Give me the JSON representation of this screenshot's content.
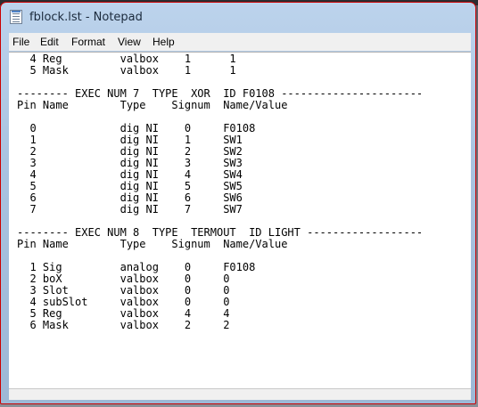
{
  "window": {
    "title": "fblock.lst - Notepad"
  },
  "menu": {
    "file": "File",
    "edit": "Edit",
    "format": "Format",
    "view": "View",
    "help": "Help"
  },
  "document": {
    "lines": [
      "  4 Reg         valbox    1      1",
      "  5 Mask        valbox    1      1",
      "",
      "-------- EXEC NUM 7  TYPE  XOR  ID F0108 ----------------------",
      "Pin Name        Type    Signum  Name/Value",
      "",
      "  0             dig NI    0     F0108",
      "  1             dig NI    1     SW1",
      "  2             dig NI    2     SW2",
      "  3             dig NI    3     SW3",
      "  4             dig NI    4     SW4",
      "  5             dig NI    5     SW5",
      "  6             dig NI    6     SW6",
      "  7             dig NI    7     SW7",
      "",
      "-------- EXEC NUM 8  TYPE  TERMOUT  ID LIGHT ------------------",
      "Pin Name        Type    Signum  Name/Value",
      "",
      "  1 Sig         analog    0     F0108",
      "  2 boX         valbox    0     0",
      "  3 Slot        valbox    0     0",
      "  4 subSlot     valbox    0     0",
      "  5 Reg         valbox    4     4",
      "  6 Mask        valbox    2     2"
    ]
  }
}
